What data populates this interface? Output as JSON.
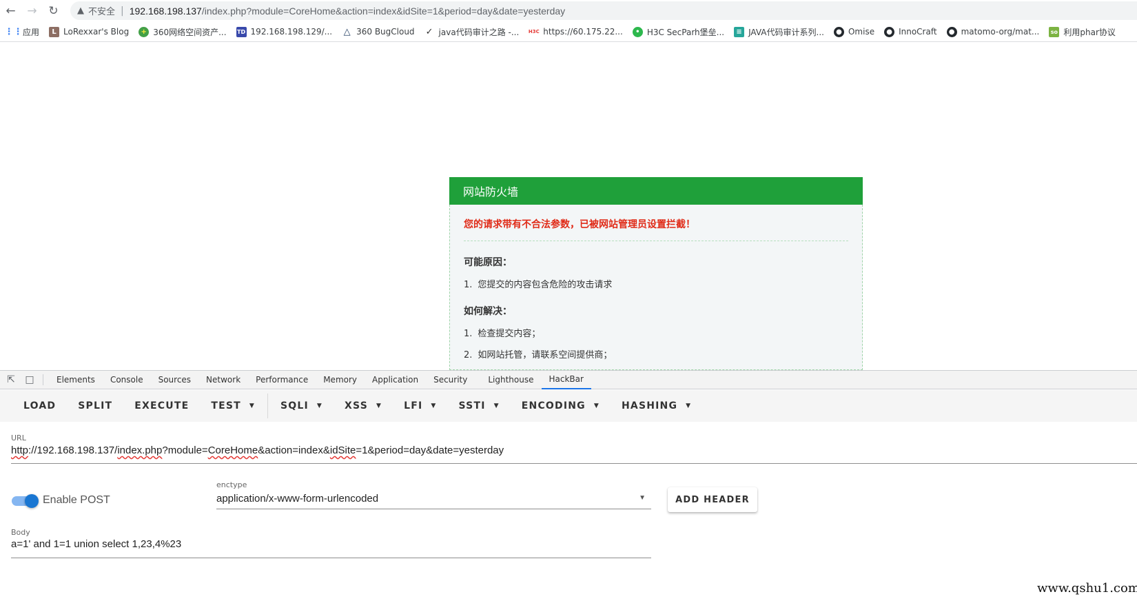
{
  "browser": {
    "insecure_label": "不安全",
    "url_host": "192.168.198.137",
    "url_path": "/index.php?module=CoreHome&action=index&idSite=1&period=day&date=yesterday"
  },
  "bookmarks": [
    {
      "label": "应用",
      "icon": "apps-grid-icon",
      "color": "#4285f4"
    },
    {
      "label": "LoRexxar's Blog",
      "icon": "blog-icon",
      "color": "#8d6e63"
    },
    {
      "label": "360网络空间资产...",
      "icon": "360-icon",
      "color": "#43a047"
    },
    {
      "label": "192.168.198.129/...",
      "icon": "td-icon",
      "color": "#3949ab"
    },
    {
      "label": "360 BugCloud",
      "icon": "triangle-icon",
      "color": "#1e3a5f"
    },
    {
      "label": "java代码审计之路 -...",
      "icon": "feather-icon",
      "color": "#333333"
    },
    {
      "label": "https://60.175.22...",
      "icon": "h3c-icon",
      "color": "#e53935"
    },
    {
      "label": "H3C SecParh堡垒...",
      "icon": "wechat-icon",
      "color": "#2db84d"
    },
    {
      "label": "JAVA代码审计系列...",
      "icon": "doc-icon",
      "color": "#26a69a"
    },
    {
      "label": "Omise",
      "icon": "github-icon",
      "color": "#24292e"
    },
    {
      "label": "InnoCraft",
      "icon": "github-icon",
      "color": "#24292e"
    },
    {
      "label": "matomo-org/mat...",
      "icon": "github-icon",
      "color": "#24292e"
    },
    {
      "label": "利用phar协议",
      "icon": "so-icon",
      "color": "#7cb342"
    }
  ],
  "waf": {
    "title": "网站防火墙",
    "alert": "您的请求带有不合法参数，已被网站管理员设置拦截！",
    "reasons_heading": "可能原因：",
    "reasons": [
      "您提交的内容包含危险的攻击请求"
    ],
    "solutions_heading": "如何解决：",
    "solutions": [
      "检查提交内容；",
      "如网站托管，请联系空间提供商；"
    ]
  },
  "devtools": {
    "tabs": [
      "Elements",
      "Console",
      "Sources",
      "Network",
      "Performance",
      "Memory",
      "Application",
      "Security",
      "Lighthouse",
      "HackBar"
    ],
    "active_tab": "HackBar"
  },
  "hackbar": {
    "menu": [
      "LOAD",
      "SPLIT",
      "EXECUTE",
      "TEST",
      "SQLI",
      "XSS",
      "LFI",
      "SSTI",
      "ENCODING",
      "HASHING"
    ],
    "url_label": "URL",
    "url_scheme": "http",
    "url_rest_a": "://192.168.198.137/",
    "url_index": "index.php",
    "url_rest_b": "?module=",
    "url_corehome": "CoreHome",
    "url_rest_c": "&action=index&",
    "url_idsite": "idSite",
    "url_rest_d": "=1&period=day&date=yesterday",
    "enable_post_label": "Enable POST",
    "enable_post": true,
    "enctype_label": "enctype",
    "enctype_value": "application/x-www-form-urlencoded",
    "add_header_label": "ADD HEADER",
    "body_label": "Body",
    "body_value": "a=1' and 1=1 union select 1,23,4%23"
  },
  "watermark": "www.qshu1.com"
}
